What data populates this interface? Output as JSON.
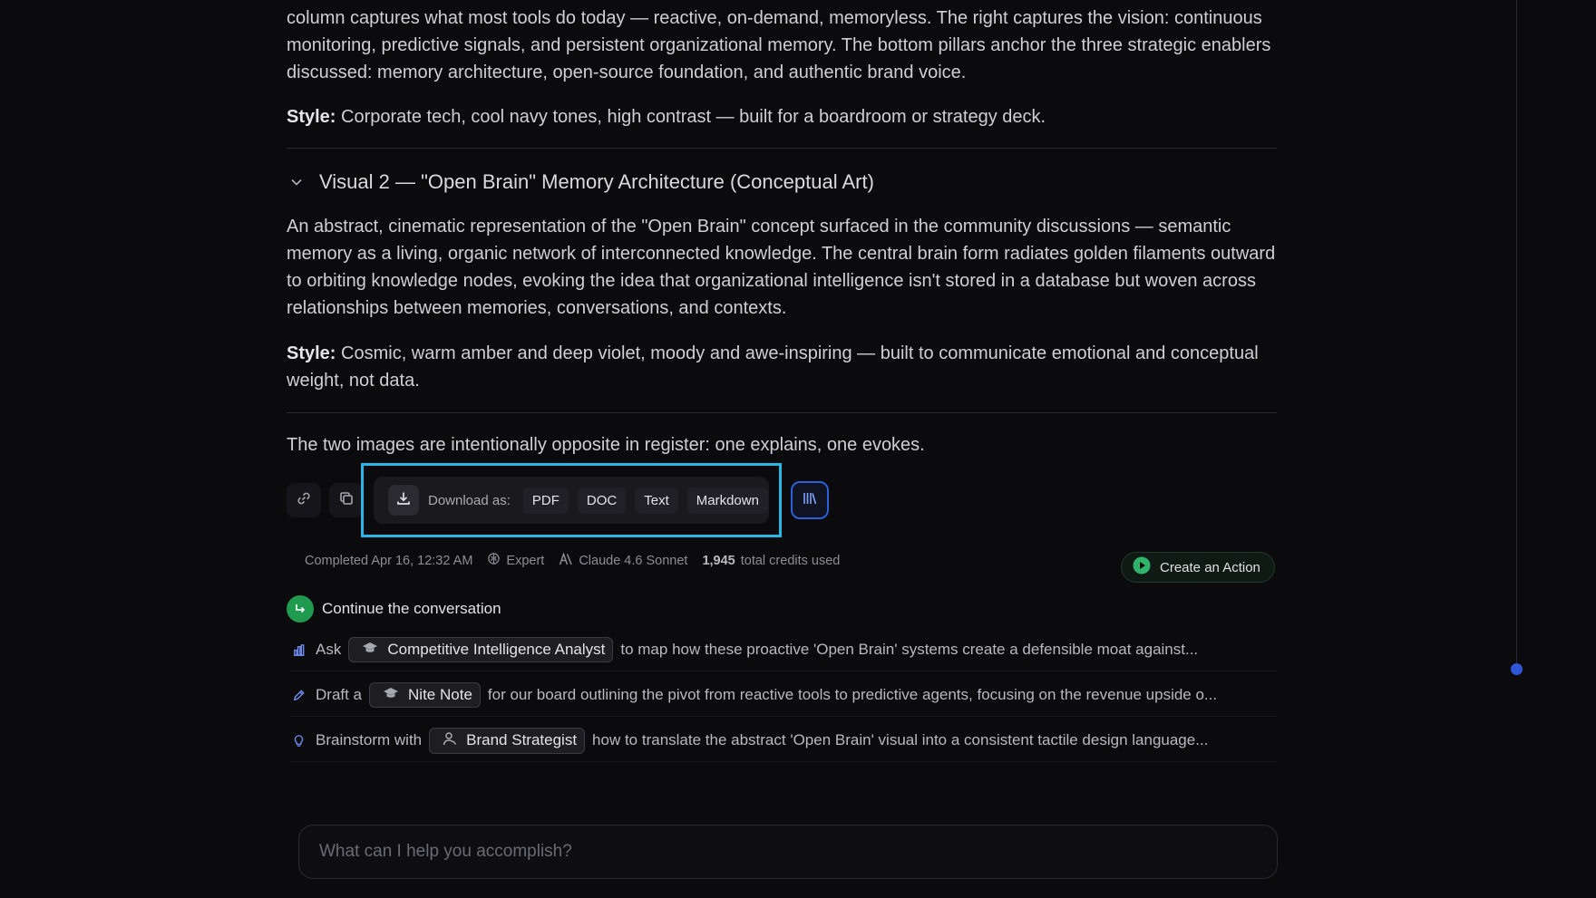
{
  "content": {
    "intro_para": "column captures what most tools do today — reactive, on-demand, memoryless. The right captures the vision: continuous monitoring, predictive signals, and persistent organizational memory. The bottom pillars anchor the three strategic enablers discussed: memory architecture, open-source foundation, and authentic brand voice.",
    "style1_label": "Style:",
    "style1_text": " Corporate tech, cool navy tones, high contrast — built for a boardroom or strategy deck.",
    "visual2_heading": "Visual 2 — \"Open Brain\" Memory Architecture (Conceptual Art)",
    "visual2_para": "An abstract, cinematic representation of the \"Open Brain\" concept surfaced in the community discussions — semantic memory as a living, organic network of interconnected knowledge. The central brain form radiates golden filaments outward to orbiting knowledge nodes, evoking the idea that organizational intelligence isn't stored in a database but woven across relationships between memories, conversations, and contexts.",
    "style2_label": "Style:",
    "style2_text": " Cosmic, warm amber and deep violet, moody and awe-inspiring — built to communicate emotional and conceptual weight, not data.",
    "closing": "The two images are intentionally opposite in register: one explains, one evokes."
  },
  "toolbar": {
    "download_label": "Download as:",
    "formats": [
      "PDF",
      "DOC",
      "Text",
      "Markdown"
    ]
  },
  "meta": {
    "completed": "Completed Apr 16, 12:32 AM",
    "mode": "Expert",
    "model": "Claude 4.6 Sonnet",
    "credits_num": "1,945",
    "credits_text": "total credits used",
    "action_label": "Create an Action"
  },
  "continue": {
    "title": "Continue the conversation",
    "suggestions": [
      {
        "prefix": "Ask",
        "chip": "Competitive Intelligence Analyst",
        "text": "to map how these proactive 'Open Brain' systems create a defensible moat against..."
      },
      {
        "prefix": "Draft a",
        "chip": "Nite Note",
        "text": "for our board outlining the pivot from reactive tools to predictive agents, focusing on the revenue upside o..."
      },
      {
        "prefix": "Brainstorm with",
        "chip": "Brand Strategist",
        "text": "how to translate the abstract 'Open Brain' visual into a consistent tactile design language..."
      }
    ]
  },
  "composer": {
    "placeholder": "What can I help you accomplish?"
  },
  "icons": {
    "link": "link-icon",
    "copy": "copy-icon",
    "download": "download-icon",
    "library": "library-icon",
    "expert": "brain-icon",
    "model": "anthropic-icon",
    "action": "play-icon",
    "continue": "return-arrow-icon",
    "chart": "bar-chart-icon",
    "pen": "pen-icon",
    "bulb": "lightbulb-icon",
    "cap": "graduation-cap-icon",
    "user": "user-icon"
  },
  "colors": {
    "background": "#0b0b0d",
    "highlight_frame": "#28b8e8",
    "accent_blue": "#2d5fd6",
    "accent_green": "#1f9a4f"
  }
}
